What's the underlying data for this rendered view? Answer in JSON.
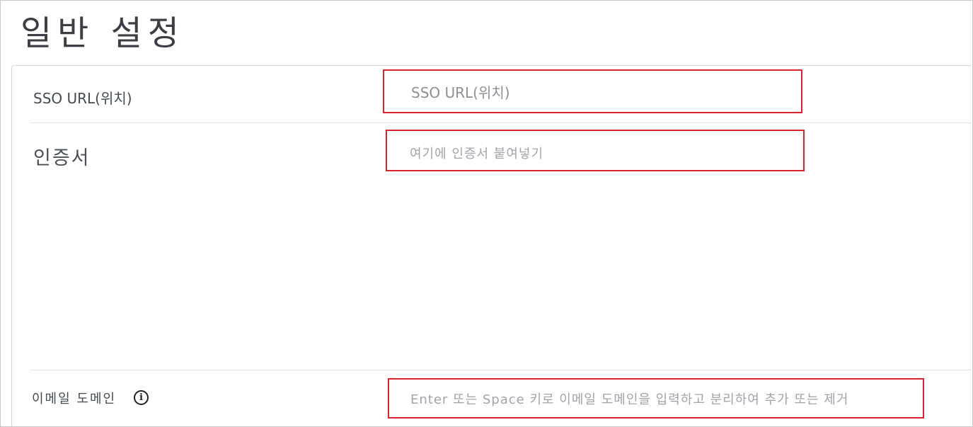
{
  "page": {
    "title": "일반 설정"
  },
  "form": {
    "sso_url": {
      "label": "SSO URL(위치)",
      "placeholder": "SSO URL(위치)"
    },
    "certificate": {
      "label": "인증서",
      "placeholder": "여기에 인증서 붙여넣기"
    },
    "email_domain": {
      "label": "이메일 도메인",
      "info_icon": "info-circle-icon",
      "placeholder": "Enter 또는 Space 키로 이메일 도메인을 입력하고 분리하여 추가 또는 제거"
    }
  },
  "colors": {
    "highlight_border": "#d9232f",
    "label_text": "#444a52",
    "placeholder_text": "#a0a4aa"
  }
}
